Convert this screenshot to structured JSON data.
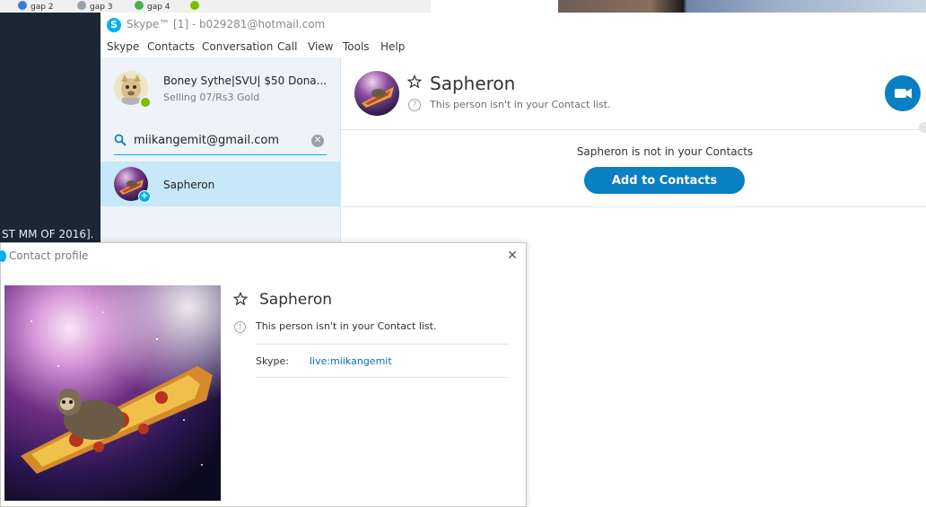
{
  "background": {
    "taskbar_items": [
      "gap 2",
      "gap 3",
      "gap 4"
    ],
    "left_window_text": "ST MM OF 2016]."
  },
  "window": {
    "title": "Skype™ [1] - b029281@hotmail.com",
    "logo_letter": "S"
  },
  "menu": [
    "Skype",
    "Contacts",
    "Conversation",
    "Call",
    "View",
    "Tools",
    "Help"
  ],
  "me": {
    "name": "Boney Sythe|SVU| $50 Dona...",
    "mood": "Selling 07/Rs3 Gold",
    "status": "online",
    "status_color": "#7fba00"
  },
  "search": {
    "value": "miikangemit@gmail.com",
    "icon": "search-icon",
    "clear_icon": "clear-icon",
    "clear_glyph": "✕"
  },
  "contacts": [
    {
      "name": "Sapheron",
      "badge": "+",
      "selected": true
    }
  ],
  "conversation": {
    "name": "Sapheron",
    "subtitle": "This person isn't in your Contact list.",
    "help_glyph": "?",
    "notice": "Sapheron is not in your Contacts",
    "add_button": "Add to Contacts",
    "accent": "#0a7fc2"
  },
  "profile_dialog": {
    "title": "Contact profile",
    "close_glyph": "✕",
    "name": "Sapheron",
    "subtitle": "This person isn't in your Contact list.",
    "help_glyph": "?",
    "skype_label": "Skype:",
    "skype_value": "live:miikangemit"
  }
}
